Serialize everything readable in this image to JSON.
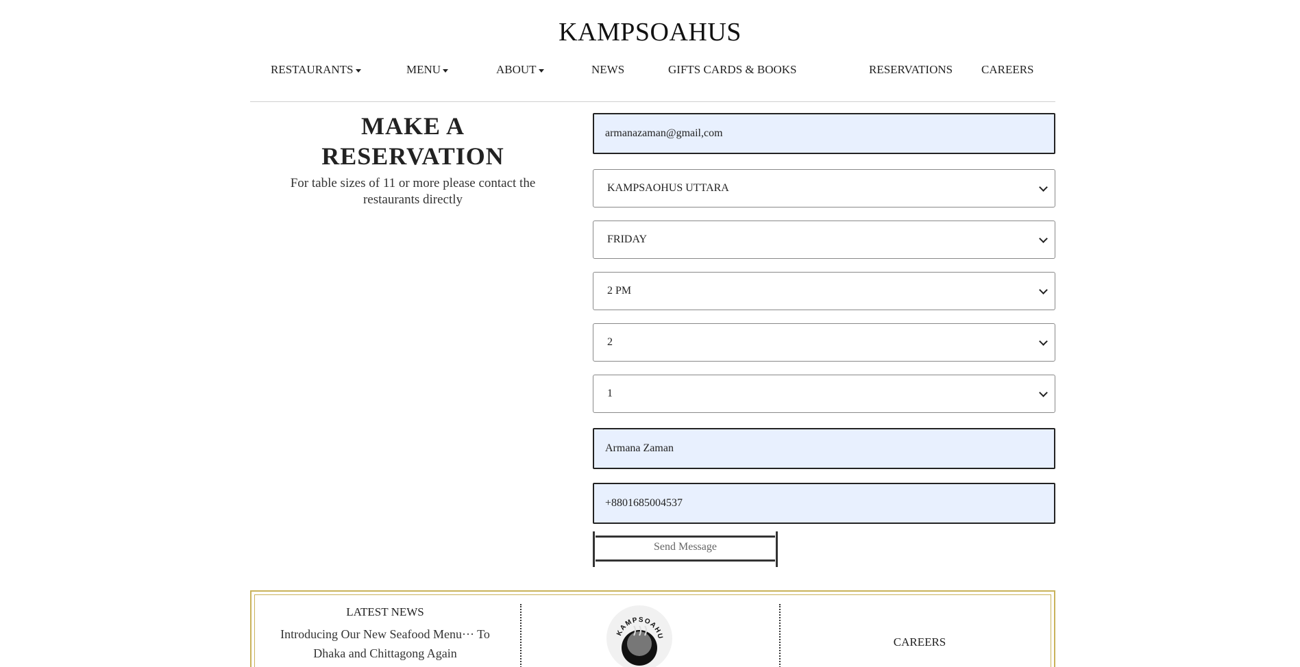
{
  "header": {
    "brand": "KAMPSOAHUS"
  },
  "nav": {
    "items": [
      {
        "label": "RESTAURANTS",
        "has_dropdown": true
      },
      {
        "label": "MENU",
        "has_dropdown": true
      },
      {
        "label": "ABOUT",
        "has_dropdown": true
      },
      {
        "label": "NEWS",
        "has_dropdown": false
      },
      {
        "label": "GIFTS CARDS & BOOKS",
        "has_dropdown": false
      },
      {
        "label": "RESERVATIONS",
        "has_dropdown": false
      },
      {
        "label": "CAREERS",
        "has_dropdown": false
      }
    ]
  },
  "reservation": {
    "title": "MAKE A RESERVATION",
    "subtitle": "For table sizes of 11 or more please contact the restaurants directly",
    "email_value": "armanazaman@gmail,com",
    "restaurant_selected": "KAMPSAOHUS UTTARA",
    "day_selected": "FRIDAY",
    "time_selected": "2 PM",
    "guests_selected": "2",
    "tables_selected": "1",
    "name_value": "Armana Zaman",
    "phone_value": "+8801685004537",
    "submit_label": "Send Message"
  },
  "footer": {
    "news_heading": "LATEST NEWS",
    "news_text": "Introducing Our New Seafood Menu··· To Dhaka and Chittagong Again",
    "logo_text": "KAMPSOAHUS",
    "careers_label": "CAREERS"
  },
  "colors": {
    "autofill_bg": "#e8f0fe",
    "footer_border": "#c9b25a",
    "text": "#222222"
  }
}
